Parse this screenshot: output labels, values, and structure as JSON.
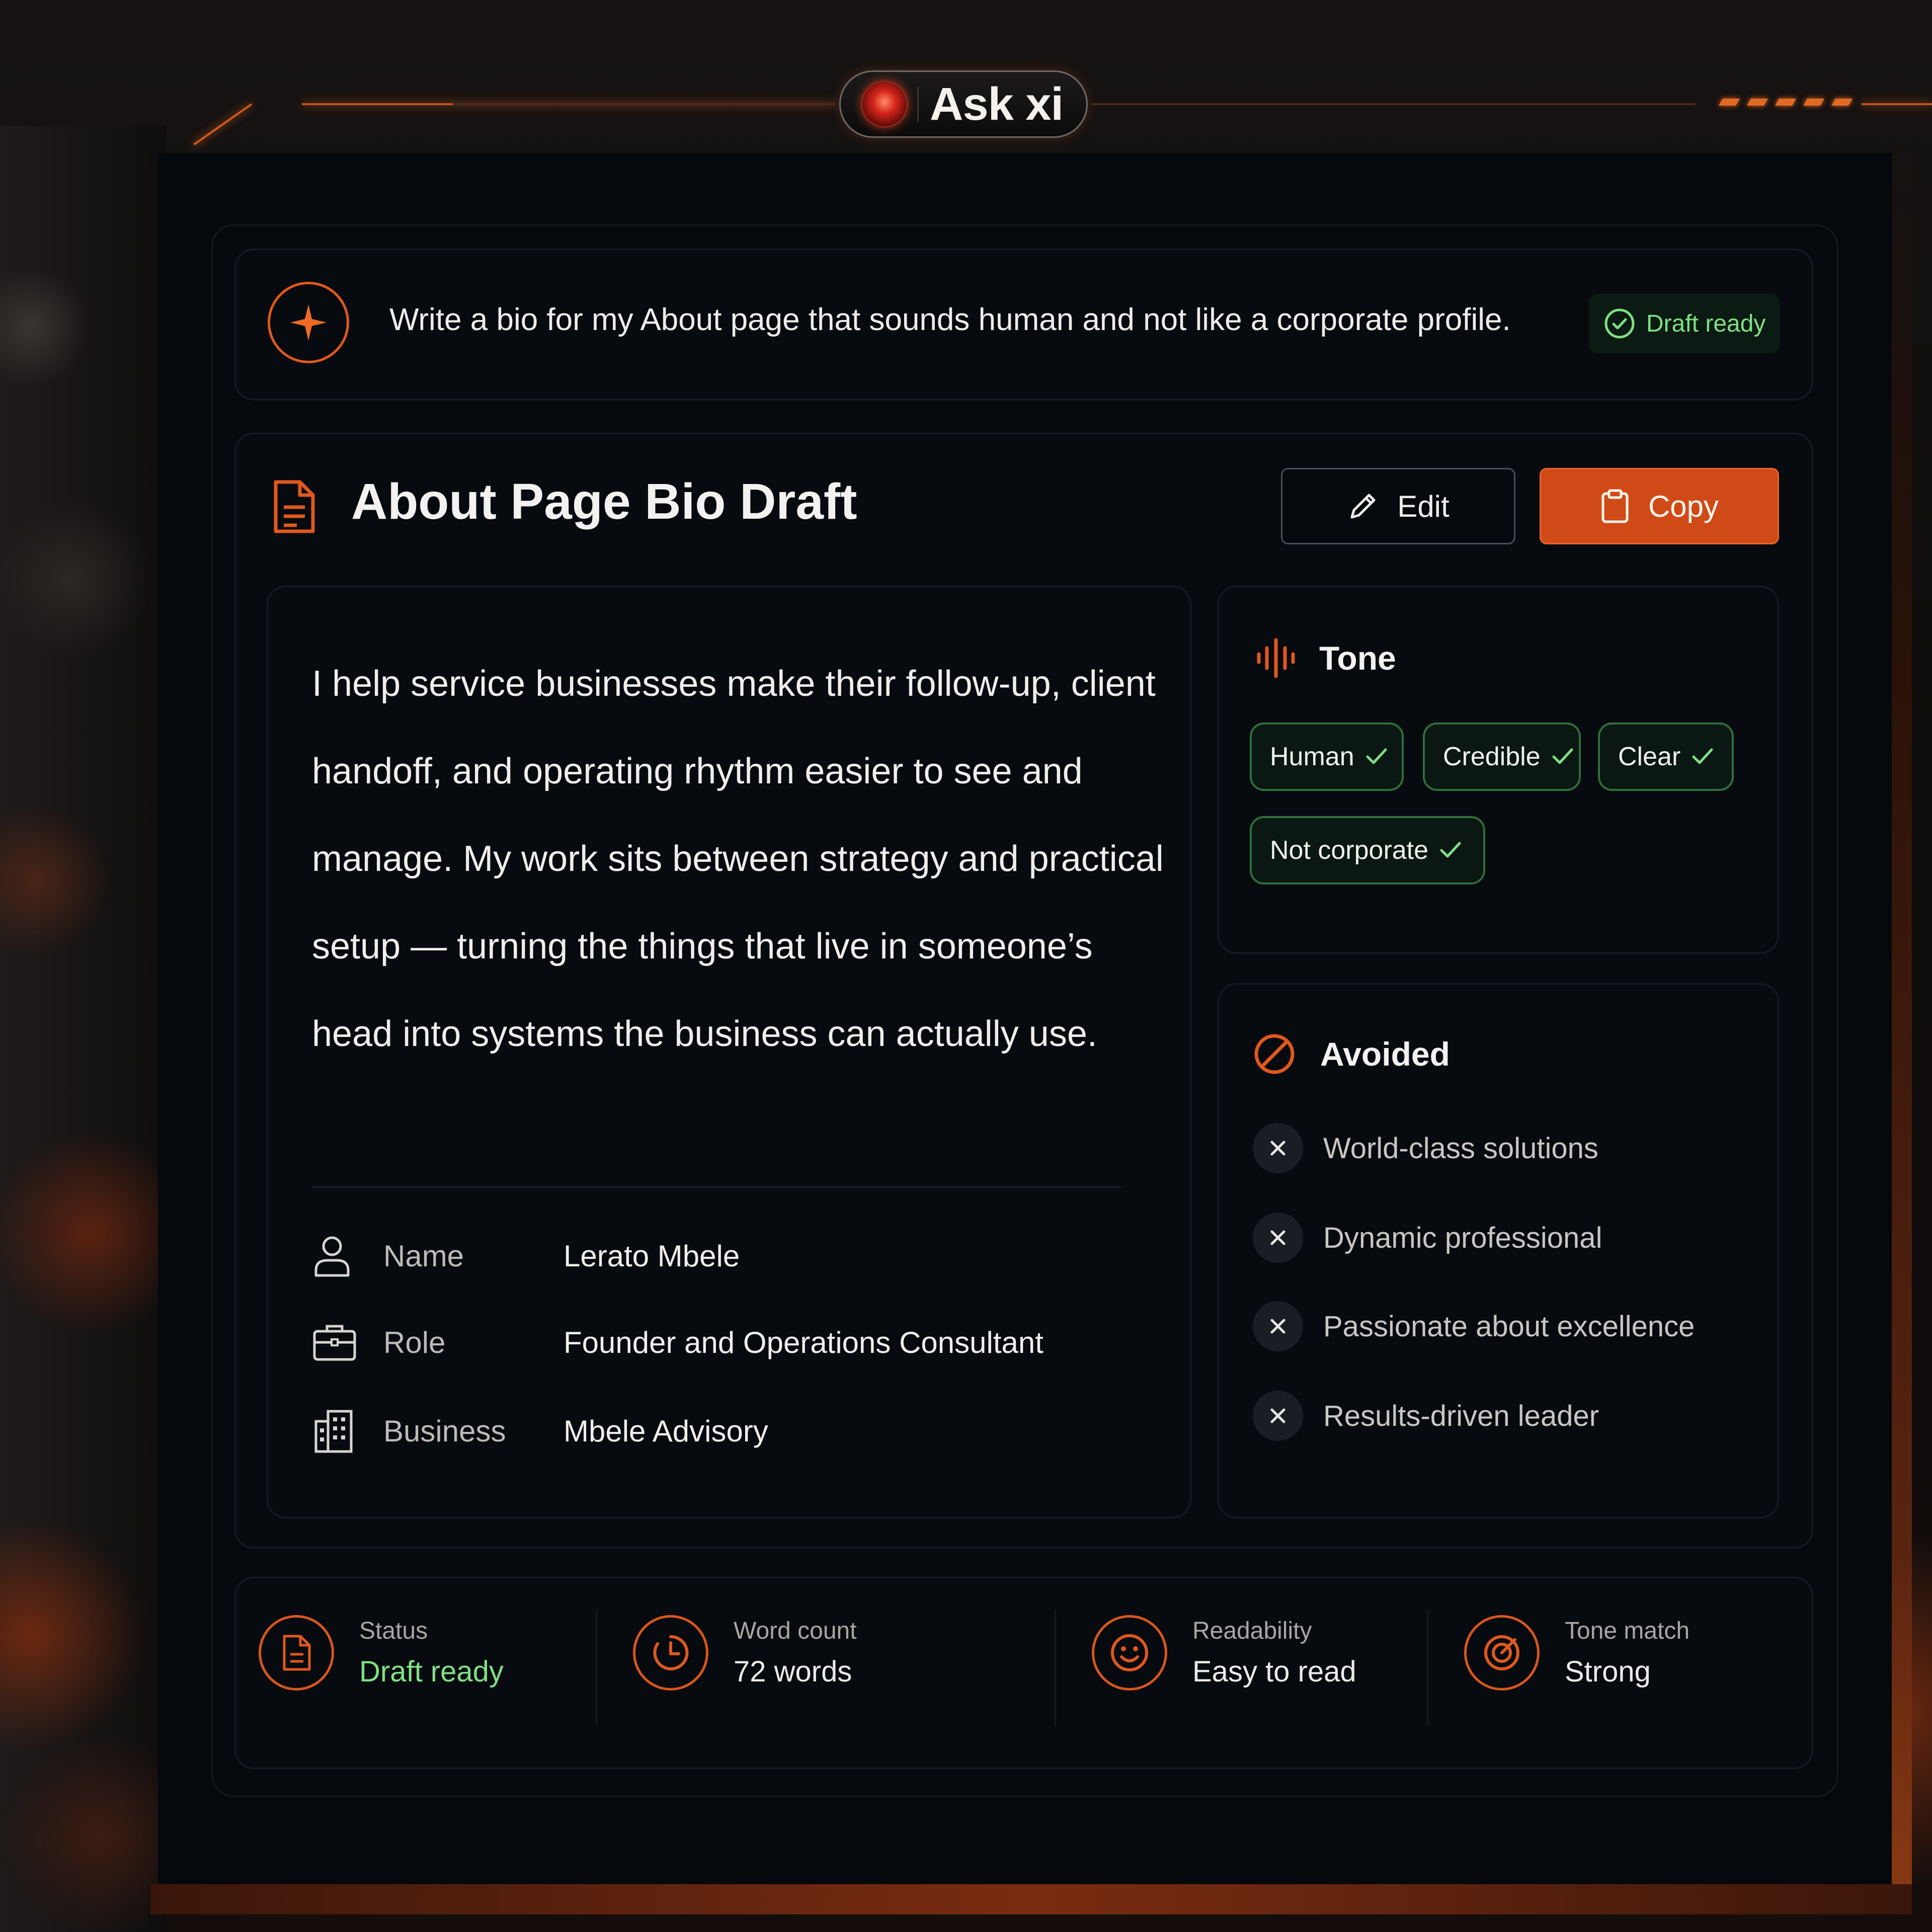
{
  "app": {
    "title": "Ask xi"
  },
  "prompt": {
    "text": "Write a bio for my About page that sounds human and not like a corporate profile.",
    "status_badge": "Draft ready"
  },
  "draft": {
    "title": "About Page Bio Draft",
    "edit_label": "Edit",
    "copy_label": "Copy",
    "bio": "I help service businesses make their follow-up, client handoff, and operating rhythm easier to see and manage. My work sits between strategy and practical setup — turning the things that live in someone’s head into systems the business can actually use.",
    "details": [
      {
        "icon": "user-icon",
        "label": "Name",
        "value": "Lerato Mbele"
      },
      {
        "icon": "briefcase-icon",
        "label": "Role",
        "value": "Founder and Operations Consultant"
      },
      {
        "icon": "building-icon",
        "label": "Business",
        "value": "Mbele Advisory"
      }
    ]
  },
  "tone": {
    "title": "Tone",
    "chips": [
      "Human",
      "Credible",
      "Clear",
      "Not corporate"
    ]
  },
  "avoided": {
    "title": "Avoided",
    "items": [
      "World-class solutions",
      "Dynamic professional",
      "Passionate about excellence",
      "Results-driven leader"
    ]
  },
  "stats": [
    {
      "icon": "document-icon",
      "label": "Status",
      "value": "Draft ready"
    },
    {
      "icon": "clock-icon",
      "label": "Word count",
      "value": "72 words"
    },
    {
      "icon": "smiley-icon",
      "label": "Readability",
      "value": "Easy to read"
    },
    {
      "icon": "target-icon",
      "label": "Tone match",
      "value": "Strong"
    }
  ],
  "colors": {
    "accent": "#e0581e",
    "success": "#7fe083",
    "chip_border": "#2e6f3b",
    "background": "#05080c"
  }
}
